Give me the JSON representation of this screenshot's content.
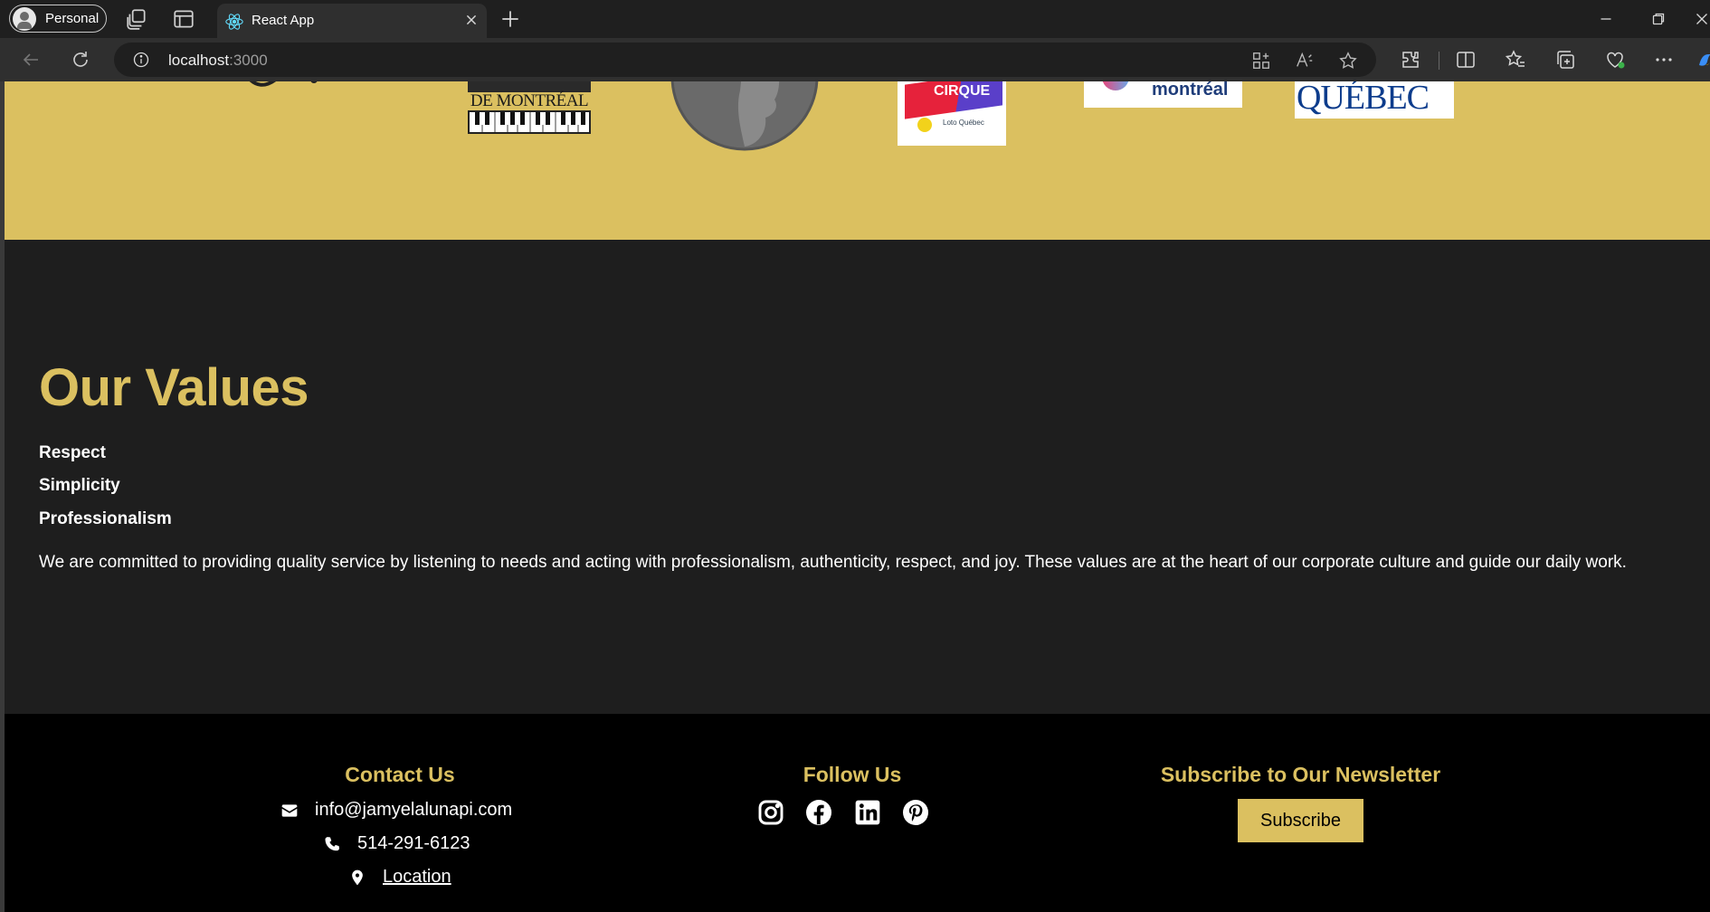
{
  "browser": {
    "profile_label": "Personal",
    "tab_title": "React App",
    "url_host": "localhost",
    "url_port": ":3000"
  },
  "values_section": {
    "heading": "Our Values",
    "items": [
      "Respect",
      "Simplicity",
      "Professionalism"
    ],
    "description": "We are committed to providing quality service by listening to needs and acting with professionalism, authenticity, respect, and joy. These values are at the heart of our corporate culture and guide our daily work."
  },
  "sponsors": {
    "logo_texts": [
      "DE MONTRÉAL",
      "CIRQUE",
      "montréal",
      "QUÉBEC",
      "Loto Québec"
    ]
  },
  "footer": {
    "contact": {
      "heading": "Contact Us",
      "email": "info@jamyelalunapi.com",
      "phone": "514-291-6123",
      "location_label": "Location"
    },
    "follow": {
      "heading": "Follow Us",
      "icons": [
        "instagram-icon",
        "facebook-icon",
        "linkedin-icon",
        "pinterest-icon"
      ]
    },
    "newsletter": {
      "heading": "Subscribe to Our Newsletter",
      "button_label": "Subscribe"
    }
  },
  "colors": {
    "accent_gold": "#dbc060",
    "section_dark": "#1e1e1e",
    "footer_black": "#000000"
  }
}
